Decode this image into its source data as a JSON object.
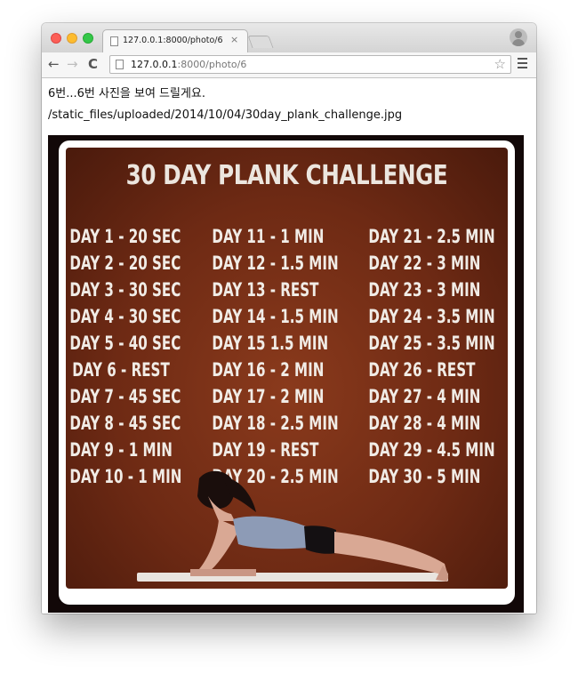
{
  "browser": {
    "tab_title": "127.0.0.1:8000/photo/6",
    "url_host": "127.0.0.1",
    "url_path": ":8000/photo/6",
    "tab_close": "×",
    "nav": {
      "back": "←",
      "forward": "→",
      "reload": "C"
    },
    "star": "☆"
  },
  "page": {
    "heading": "6번...6번 사진을 보여 드릴게요.",
    "file_path": "/static_files/uploaded/2014/10/04/30day_plank_challenge.jpg"
  },
  "poster": {
    "title": "30 DAY PLANK CHALLENGE",
    "days": [
      [
        "DAY 1 - 20 SEC",
        "DAY 11 - 1 MIN",
        "DAY 21 - 2.5 MIN"
      ],
      [
        "DAY 2 - 20 SEC",
        "DAY 12 - 1.5 MIN",
        "DAY 22 - 3 MIN"
      ],
      [
        "DAY 3 - 30 SEC",
        "DAY 13 - REST",
        "DAY 23 - 3 MIN"
      ],
      [
        "DAY 4 - 30 SEC",
        "DAY 14 - 1.5 MIN",
        "DAY 24 - 3.5 MIN"
      ],
      [
        "DAY 5 - 40 SEC",
        "DAY 15 1.5 MIN",
        "DAY 25 - 3.5 MIN"
      ],
      [
        "DAY 6 - REST",
        "DAY 16 - 2 MIN",
        "DAY 26 - REST"
      ],
      [
        "DAY 7 - 45 SEC",
        "DAY 17 - 2 MIN",
        "DAY 27 - 4 MIN"
      ],
      [
        "DAY 8 - 45 SEC",
        "DAY 18 - 2.5 MIN",
        "DAY 28 - 4 MIN"
      ],
      [
        "DAY 9 - 1 MIN",
        "DAY 19 - REST",
        "DAY 29 - 4.5 MIN"
      ],
      [
        "DAY 10 - 1 MIN",
        "DAY 20 - 2.5 MIN",
        "DAY 30 - 5 MIN"
      ]
    ]
  }
}
